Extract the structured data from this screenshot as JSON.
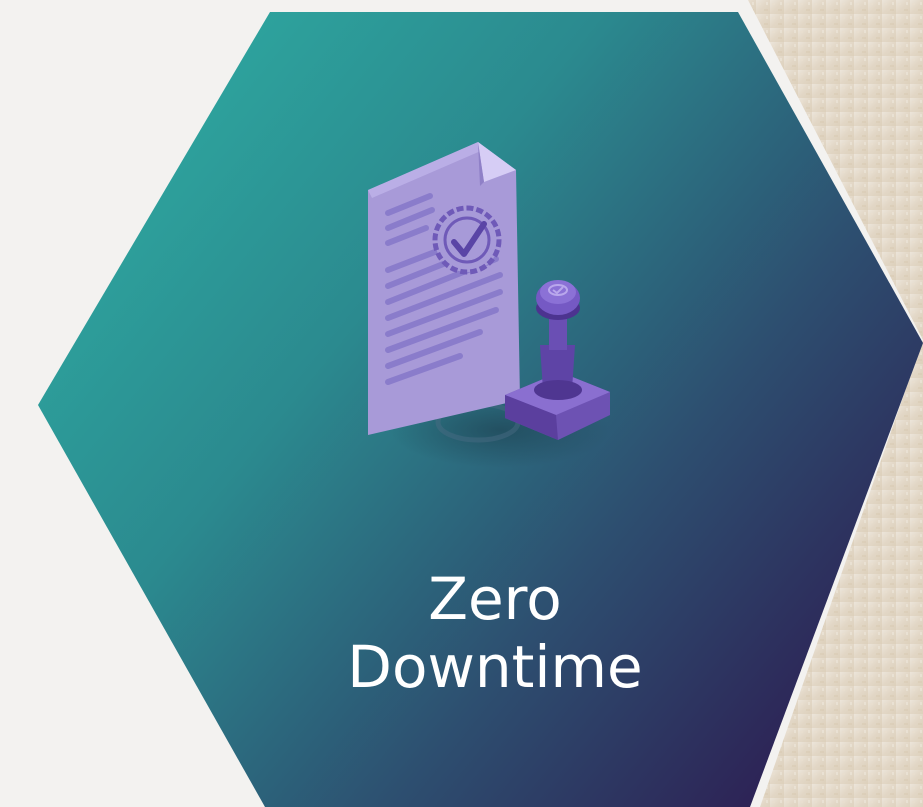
{
  "card": {
    "title_line1": "Zero",
    "title_line2": "Downtime"
  },
  "illustration": {
    "icon": "document-stamp-icon"
  },
  "colors": {
    "page_background": "#f3f2f0",
    "hexagon_gradient_start": "#2ea59d",
    "hexagon_gradient_end": "#2d2456",
    "texture_background": "#e6dccd",
    "illustration_purple": "#9c86d8",
    "text": "#ffffff"
  }
}
